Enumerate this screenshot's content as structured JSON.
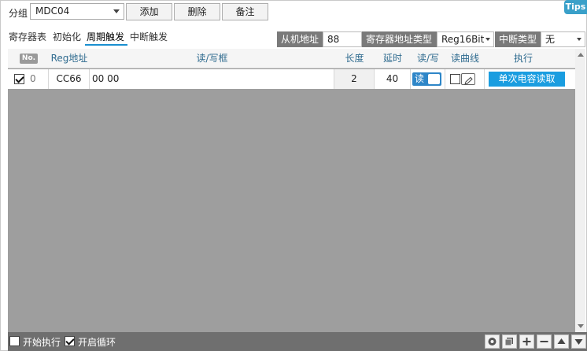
{
  "toolbar": {
    "group_label": "分组",
    "group_value": "MDC04",
    "add_label": "添加",
    "delete_label": "删除",
    "note_label": "备注",
    "tips_label": "Tips"
  },
  "tabs": [
    {
      "label": "寄存器表"
    },
    {
      "label": "初始化"
    },
    {
      "label": "周期触发"
    },
    {
      "label": "中断触发"
    }
  ],
  "params": {
    "slave_addr_label": "从机地址",
    "slave_addr_value": "88",
    "reg_type_label": "寄存器地址类型",
    "reg_type_value": "Reg16Bit",
    "int_type_label": "中断类型",
    "int_type_value": "无"
  },
  "table": {
    "headers": {
      "no": "No.",
      "reg": "Reg地址",
      "rw_box": "读/写框",
      "length": "长度",
      "delay": "延时",
      "rw": "读/写",
      "curve": "读曲线",
      "exec": "执行"
    },
    "rows": [
      {
        "no": "0",
        "reg": "CC66",
        "data": "00 00",
        "length": "2",
        "delay": "40",
        "rw": "读",
        "exec_label": "单次电容读取"
      }
    ]
  },
  "bottom": {
    "start_label": "开始执行",
    "loop_label": "开启循环"
  },
  "colors": {
    "accent": "#1a9de0",
    "toggle": "#2e86c8",
    "grid_bg": "#9e9e9e",
    "bottom_bar": "#6f6f6f",
    "param_label_bg": "#7a7a7a"
  }
}
